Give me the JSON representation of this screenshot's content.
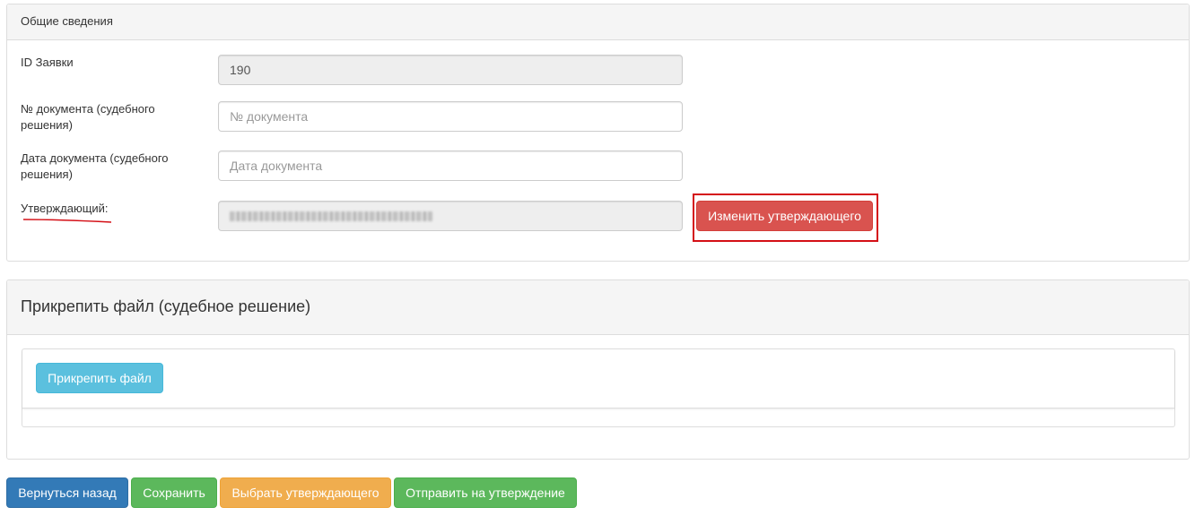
{
  "general": {
    "heading": "Общие сведения",
    "id_label": "ID Заявки",
    "id_value": "190",
    "doc_number_label": "№ документа (судебного решения)",
    "doc_number_placeholder": "№ документа",
    "doc_date_label": "Дата документа (судебного решения)",
    "doc_date_placeholder": "Дата документа",
    "approver_label": "Утверждающий:",
    "change_approver_button": "Изменить утверждающего"
  },
  "attach": {
    "heading": "Прикрепить файл (судебное решение)",
    "attach_button": "Прикрепить файл"
  },
  "footer": {
    "back_button": "Вернуться назад",
    "save_button": "Сохранить",
    "select_approver_button": "Выбрать утверждающего",
    "send_button": "Отправить на утверждение"
  },
  "colors": {
    "danger": "#d9534f",
    "info": "#5bc0de",
    "primary": "#337ab7",
    "success": "#5cb85c",
    "warning": "#f0ad4e",
    "annotation_red": "#d40f16"
  }
}
